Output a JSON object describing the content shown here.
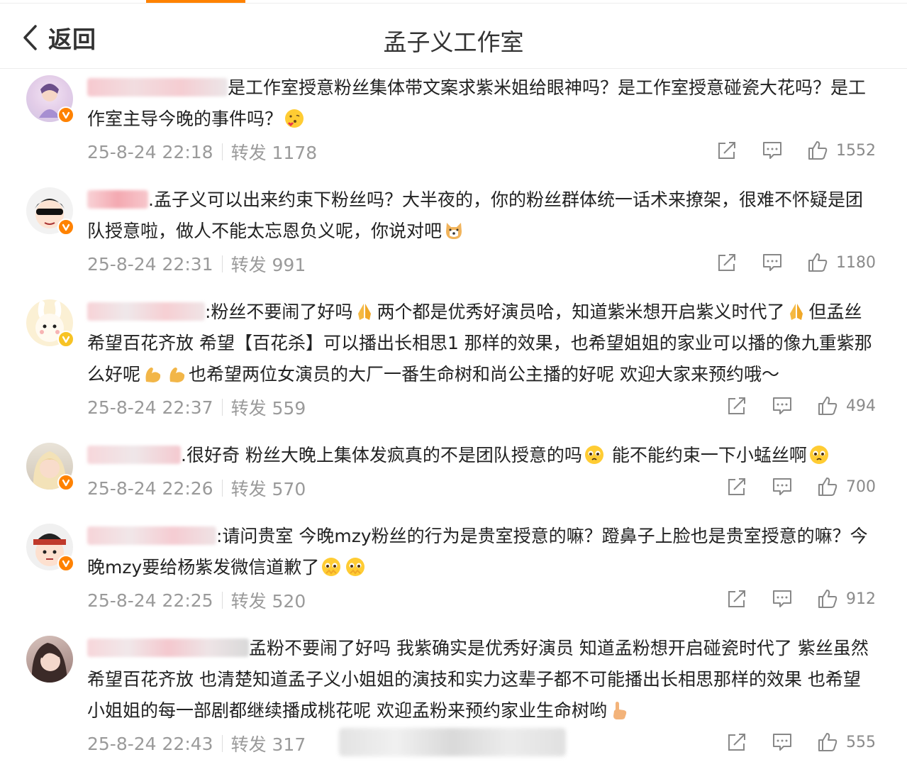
{
  "header": {
    "back_label": "返回",
    "title": "孟子义工作室"
  },
  "comments": [
    {
      "text": "是工作室授意粉丝集体带文案求紫米姐给眼神吗？是工作室授意碰瓷大花吗？是工作室主导今晚的事件吗？",
      "time": "25-8-24 22:18",
      "repost": "转发 1178",
      "likes": "1552",
      "badge_color": "#ff8200",
      "emoji": "blowing-kiss-icon"
    },
    {
      "text": ".孟子义可以出来约束下粉丝吗？大半夜的，你的粉丝群体统一话术来撩架，很难不怀疑是团队授意啦，做人不能太忘恩负义呢，你说对吧",
      "time": "25-8-24 22:31",
      "repost": "转发 991",
      "likes": "1180",
      "badge_color": "#ff8200",
      "emoji": "dog-face-icon"
    },
    {
      "text_a": ":粉丝不要闹了好吗",
      "text_b": "两个都是优秀好演员哈，知道紫米想开启紫义时代了",
      "text_c": "但孟丝希望百花齐放 希望【百花杀】可以播出长相思1 那样的效果，也希望姐姐的家业可以播的像九重紫那么好呢",
      "text_d": "也希望两位女演员的大厂一番生命树和尚公主播的好呢 欢迎大家来预约哦～",
      "time": "25-8-24 22:37",
      "repost": "转发 559",
      "likes": "494",
      "badge_color": "#f7c325",
      "emoji": "folded-hands-icon"
    },
    {
      "text_a": ".很好奇 粉丝大晚上集体发疯真的不是团队授意的吗",
      "text_b": " 能不能约束一下小蜢丝啊",
      "time": "25-8-24 22:26",
      "repost": "转发 570",
      "likes": "700",
      "badge_color": "#ff8200",
      "emoji": "pleading-face-icon"
    },
    {
      "text": ":请问贵室 今晚mzy粉丝的行为是贵室授意的嘛？蹬鼻子上脸也是贵室授意的嘛？今晚mzy要给杨紫发微信道歉了",
      "time": "25-8-24 22:25",
      "repost": "转发 520",
      "likes": "912",
      "badge_color": "#ff8200",
      "emoji": "pleading-face-icon"
    },
    {
      "text": "孟粉不要闹了好吗 我紫确实是优秀好演员 知道孟粉想开启碰瓷时代了 紫丝虽然希望百花齐放 也清楚知道孟子义小姐姐的演技和实力这辈子都不可能播出长相思那样的效果 也希望小姐姐的每一部剧都继续播成桃花呢 欢迎孟粉来预约家业生命树哟",
      "time": "25-8-24 22:43",
      "repost": "转发 317",
      "likes": "555",
      "badge_color": "#ff8200",
      "emoji": "pointing-hand-icon"
    }
  ],
  "icons": {
    "share": "share-icon",
    "comment": "comment-icon",
    "like": "thumbs-up-icon",
    "back": "chevron-left-icon",
    "verified": "verified-badge-icon"
  },
  "colors": {
    "accent": "#ff8200",
    "meta_text": "#9a9a9a"
  }
}
